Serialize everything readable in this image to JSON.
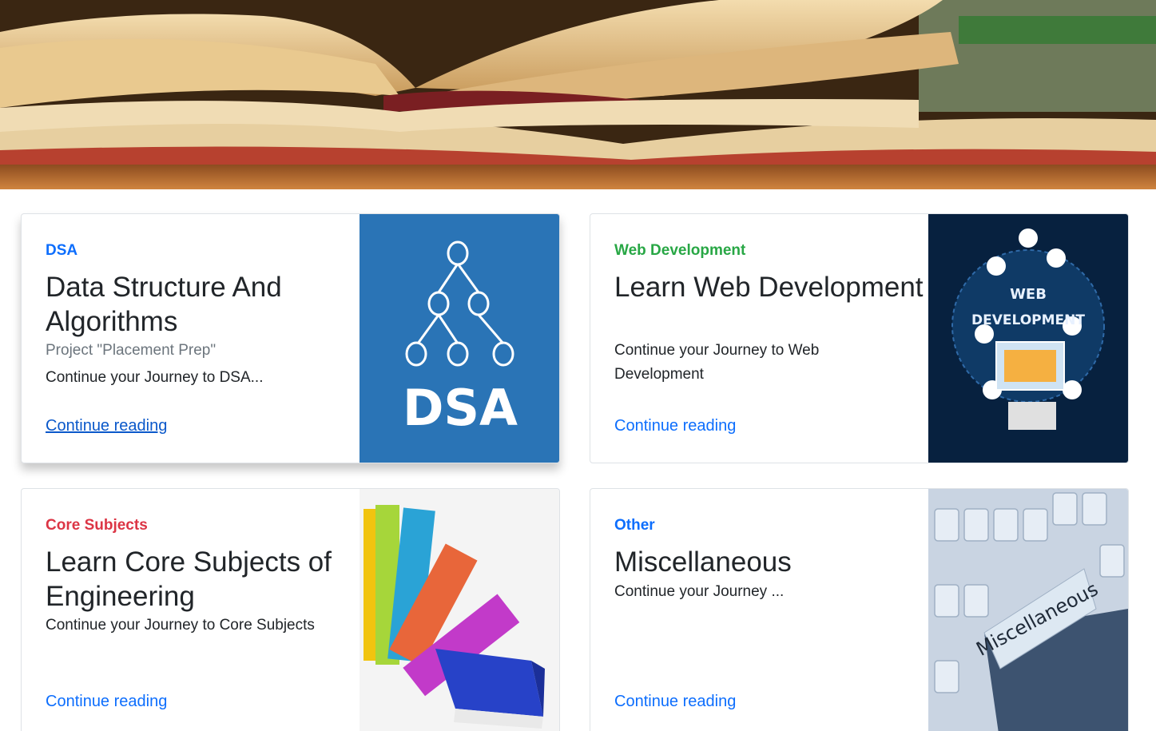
{
  "colors": {
    "dsa": "#0d6efd",
    "web": "#28a745",
    "core": "#dc3545",
    "other": "#0d6efd",
    "link": "#0d6efd"
  },
  "hero": {
    "image": "open-books-image"
  },
  "cards": [
    {
      "category": "DSA",
      "title": "Data Structure And Algorithms",
      "meta": "Project \"Placement Prep\"",
      "excerpt": "Continue your Journey to DSA...",
      "link": "Continue reading",
      "thumb_text": "DSA"
    },
    {
      "category": "Web Development",
      "title": "Learn Web Development",
      "excerpt": "Continue your Journey to Web Development",
      "link": "Continue reading",
      "thumb_text_1": "WEB",
      "thumb_text_2": "DEVELOPMENT"
    },
    {
      "category": "Core Subjects",
      "title": "Learn Core Subjects of Engineering",
      "excerpt": "Continue your Journey to Core Subjects",
      "link": "Continue reading"
    },
    {
      "category": "Other",
      "title": "Miscellaneous",
      "excerpt": "Continue your Journey ...",
      "link": "Continue reading",
      "thumb_text": "Miscellaneous"
    }
  ]
}
